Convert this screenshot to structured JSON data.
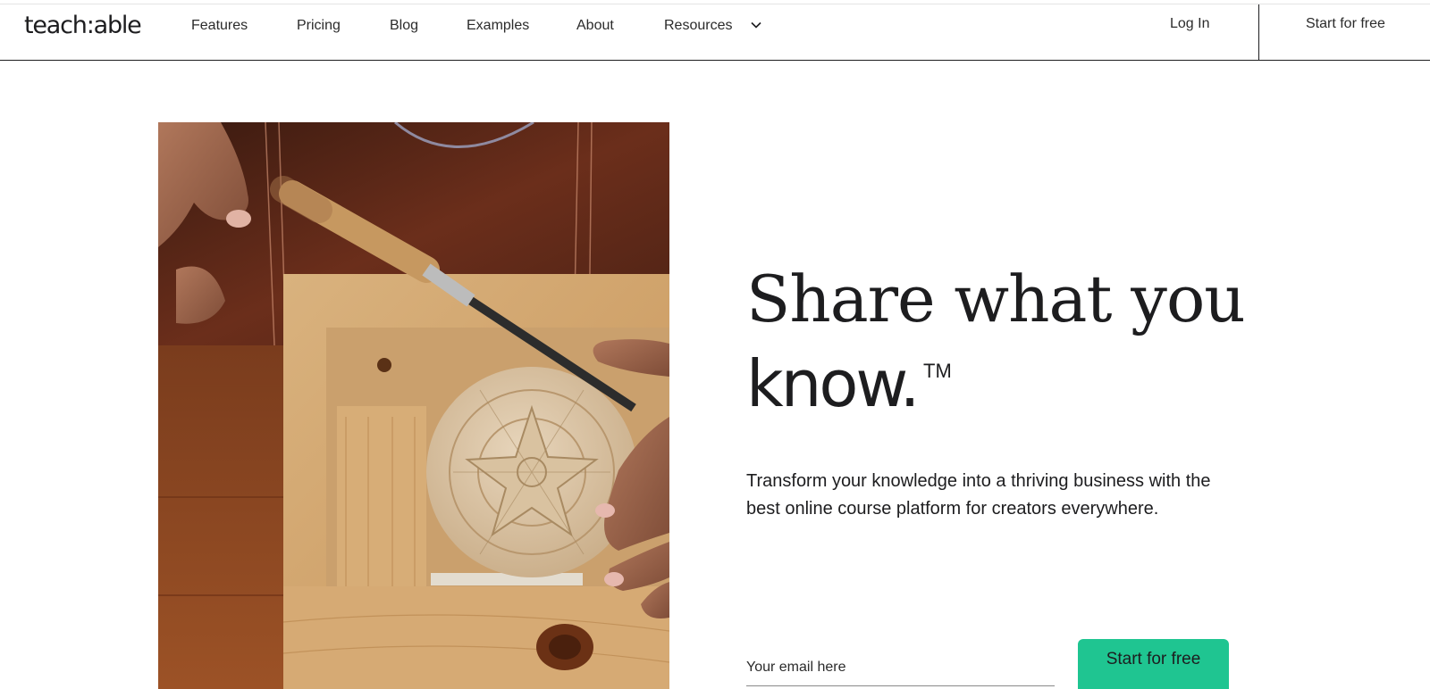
{
  "header": {
    "logo_text": "teach:able",
    "nav": {
      "features": "Features",
      "pricing": "Pricing",
      "blog": "Blog",
      "examples": "Examples",
      "about": "About",
      "resources": "Resources"
    },
    "login": "Log In",
    "start_free": "Start for free"
  },
  "hero": {
    "headline_line1": "Share what you",
    "headline_line2": "know.",
    "trademark": "TM",
    "subtext": "Transform your knowledge into a thriving business with the best online course platform for creators everywhere.",
    "email_placeholder": "Your email here",
    "cta_label": "Start for free",
    "image_subject": "hands-carving-wooden-bowl-photo"
  },
  "colors": {
    "accent": "#1fc591",
    "text": "#1d1d1f"
  }
}
